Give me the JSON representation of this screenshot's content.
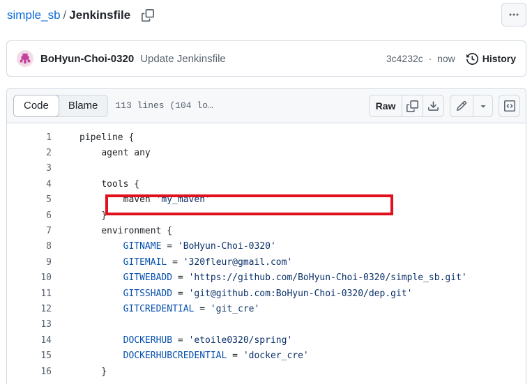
{
  "breadcrumb": {
    "repo": "simple_sb",
    "separator": "/",
    "file": "Jenkinsfile"
  },
  "commit": {
    "author": "BoHyun-Choi-0320",
    "message": "Update Jenkinsfile",
    "sha": "3c4232c",
    "separator": "·",
    "time": "now",
    "history_label": "History"
  },
  "file_header": {
    "tabs": [
      {
        "label": "Code",
        "active": true
      },
      {
        "label": "Blame",
        "active": false
      }
    ],
    "lines_info": "113 lines (104 lo…",
    "raw_label": "Raw"
  },
  "code_lines": [
    {
      "n": "1",
      "indent": "",
      "parts": [
        {
          "t": "pipeline {",
          "c": ""
        }
      ]
    },
    {
      "n": "2",
      "indent": "    ",
      "parts": [
        {
          "t": "agent any",
          "c": ""
        }
      ]
    },
    {
      "n": "3",
      "indent": "",
      "parts": []
    },
    {
      "n": "4",
      "indent": "    ",
      "parts": [
        {
          "t": "tools {",
          "c": ""
        }
      ]
    },
    {
      "n": "5",
      "indent": "        ",
      "parts": [
        {
          "t": "maven ",
          "c": ""
        },
        {
          "t": "'my_maven'",
          "c": "s"
        }
      ]
    },
    {
      "n": "6",
      "indent": "    ",
      "parts": [
        {
          "t": "}",
          "c": ""
        }
      ]
    },
    {
      "n": "7",
      "indent": "    ",
      "parts": [
        {
          "t": "environment {",
          "c": ""
        }
      ]
    },
    {
      "n": "8",
      "indent": "        ",
      "parts": [
        {
          "t": "GITNAME",
          "c": "v"
        },
        {
          "t": " = ",
          "c": ""
        },
        {
          "t": "'BoHyun-Choi-0320'",
          "c": "s"
        }
      ]
    },
    {
      "n": "9",
      "indent": "        ",
      "parts": [
        {
          "t": "GITEMAIL",
          "c": "v"
        },
        {
          "t": " = ",
          "c": ""
        },
        {
          "t": "'320fleur@gmail.com'",
          "c": "s"
        }
      ]
    },
    {
      "n": "10",
      "indent": "        ",
      "parts": [
        {
          "t": "GITWEBADD",
          "c": "v"
        },
        {
          "t": " = ",
          "c": ""
        },
        {
          "t": "'https://github.com/BoHyun-Choi-0320/simple_sb.git'",
          "c": "s"
        }
      ]
    },
    {
      "n": "11",
      "indent": "        ",
      "parts": [
        {
          "t": "GITSSHADD",
          "c": "v"
        },
        {
          "t": " = ",
          "c": ""
        },
        {
          "t": "'git@github.com:BoHyun-Choi-0320/dep.git'",
          "c": "s"
        }
      ]
    },
    {
      "n": "12",
      "indent": "        ",
      "parts": [
        {
          "t": "GITCREDENTIAL",
          "c": "v"
        },
        {
          "t": " = ",
          "c": ""
        },
        {
          "t": "'git_cre'",
          "c": "s"
        }
      ]
    },
    {
      "n": "13",
      "indent": "",
      "parts": []
    },
    {
      "n": "14",
      "indent": "        ",
      "parts": [
        {
          "t": "DOCKERHUB",
          "c": "v"
        },
        {
          "t": " = ",
          "c": ""
        },
        {
          "t": "'etoile0320/spring'",
          "c": "s"
        }
      ]
    },
    {
      "n": "15",
      "indent": "        ",
      "parts": [
        {
          "t": "DOCKERHUBCREDENTIAL",
          "c": "v"
        },
        {
          "t": " = ",
          "c": ""
        },
        {
          "t": "'docker_cre'",
          "c": "s"
        }
      ]
    },
    {
      "n": "16",
      "indent": "    ",
      "parts": [
        {
          "t": "}",
          "c": ""
        }
      ]
    }
  ],
  "icons": {
    "copy_path": "copy-icon",
    "more": "kebab-horizontal-icon",
    "history": "history-icon",
    "copy_raw": "copy-icon",
    "download": "download-icon",
    "edit": "pencil-icon",
    "dropdown": "triangle-down-icon",
    "symbols": "code-square-icon"
  },
  "colors": {
    "link": "#0969da",
    "highlight": "#e0111c",
    "variable": "#0550ae",
    "string": "#0a3069"
  }
}
